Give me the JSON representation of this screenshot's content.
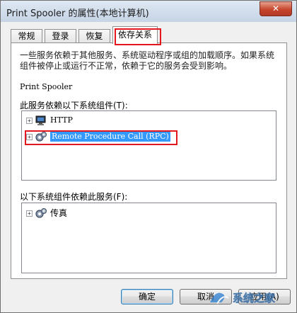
{
  "window": {
    "title": "Print Spooler 的属性(本地计算机)",
    "close_label": "✕"
  },
  "tabs": [
    {
      "label": "常规"
    },
    {
      "label": "登录"
    },
    {
      "label": "恢复"
    },
    {
      "label": "依存关系",
      "active": true
    }
  ],
  "dependencies": {
    "description": "一些服务依赖于其他服务、系统驱动程序或组的加载顺序。如果系统组件被停止或运行不正常，依赖于它的服务会受到影响。",
    "service_name": "Print Spooler",
    "depends_on_label": "此服务依赖以下系统组件(T):",
    "depends_on": [
      {
        "label": "HTTP",
        "icon": "driver-icon",
        "expandable": true
      },
      {
        "label": "Remote Procedure Call (RPC)",
        "icon": "service-gear-icon",
        "expandable": true,
        "selected": true
      }
    ],
    "dependents_label": "以下系统组件依赖此服务(F):",
    "dependents": [
      {
        "label": "传真",
        "icon": "service-gear-icon",
        "expandable": true
      }
    ]
  },
  "buttons": {
    "ok": "确定",
    "cancel": "取消",
    "apply": "应用(A)"
  },
  "watermark": {
    "text": "系统之家"
  },
  "colors": {
    "highlight_red": "#e3171d",
    "selection_blue": "#3399ff"
  }
}
